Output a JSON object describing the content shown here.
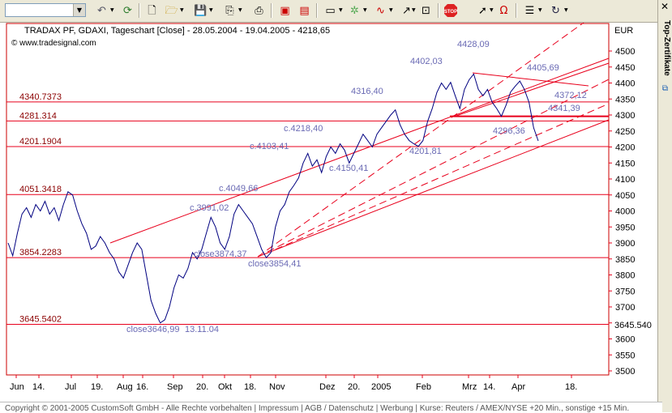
{
  "toolbar": {
    "combo_value": "",
    "buttons": [
      "back-arrow-icon",
      "refresh-icon",
      "new-doc-icon",
      "open-folder-icon",
      "save-icon",
      "copy-icon",
      "print-icon",
      "chart-window-icon",
      "chart-window-2-icon",
      "chart-type-icon",
      "indicator-icon",
      "drawing-tools-icon",
      "zoom-fit-icon",
      "stop-icon",
      "pointer-icon",
      "magnet-icon",
      "trade-list-icon",
      "undo-redo-icon"
    ]
  },
  "sidebar": {
    "label": "Top-Zertifikate"
  },
  "chart": {
    "title": "TRADAX PF, GDAXI, Tageschart [Close] - 28.05.2004 - 19.04.2005 - 4218,65",
    "source": "© www.tradesignal.com",
    "currency": "EUR",
    "y_ticks": [
      "4500",
      "4450",
      "4400",
      "4350",
      "4300",
      "4250",
      "4200",
      "4150",
      "4100",
      "4050",
      "4000",
      "3950",
      "3900",
      "3850",
      "3800",
      "3750",
      "3700",
      "3650",
      "3600",
      "3550",
      "3500"
    ],
    "x_ticks": [
      "Jun",
      "14.",
      "Jul",
      "19.",
      "Aug",
      "16.",
      "Sep",
      "20.",
      "Okt",
      "18.",
      "Nov",
      "Dez",
      "20.",
      "2005",
      "Feb",
      "Mrz",
      "14.",
      "Apr",
      "18."
    ],
    "hline_labels": [
      "4340.7373",
      "4281.314",
      "4201.1904",
      "4051.3418",
      "3854.2283",
      "3645.5402"
    ],
    "last_price_label": "3645.540",
    "annotations": [
      "4428,09",
      "4402,03",
      "4405,69",
      "4316,40",
      "4372,12",
      "4341,39",
      "c.4218,40",
      "4296,36",
      "c.4103,41",
      "4201,81",
      "c.4150,41",
      "c.4049,66",
      "c.3991,02",
      "close3874,37",
      "close3854,41",
      "close3646,99",
      "13.11.04"
    ],
    "line_color": "#e8001c",
    "price_color": "#000080",
    "annotation_color": "#6a6ab4"
  },
  "chart_data": {
    "type": "line",
    "title": "TRADAX PF, GDAXI, Tageschart [Close] - 28.05.2004 - 19.04.2005 - 4218,65",
    "ylabel": "EUR",
    "ylim": [
      3500,
      4500
    ],
    "x_range": [
      "2004-05-28",
      "2005-04-19"
    ],
    "horizontal_levels": [
      4340.7373,
      4281.314,
      4201.1904,
      4051.3418,
      3854.2283,
      3645.5402
    ],
    "series": [
      {
        "values": [
          3900,
          3860,
          3930,
          3990,
          4010,
          3980,
          4020,
          4000,
          4030,
          3990,
          4010,
          3970,
          4020,
          4060,
          4050,
          4000,
          3960,
          3930,
          3880,
          3890,
          3920,
          3900,
          3870,
          3850,
          3810,
          3790,
          3830,
          3870,
          3900,
          3880,
          3800,
          3720,
          3680,
          3650,
          3660,
          3700,
          3760,
          3800,
          3790,
          3820,
          3870,
          3850,
          3880,
          3930,
          3980,
          3950,
          3900,
          3880,
          3920,
          3990,
          4020,
          4000,
          3980,
          3960,
          3920,
          3880,
          3854,
          3870,
          3950,
          4000,
          4020,
          4060,
          4080,
          4103,
          4150,
          4180,
          4140,
          4160,
          4120,
          4170,
          4200,
          4180,
          4210,
          4190,
          4150,
          4180,
          4210,
          4240,
          4220,
          4200,
          4240,
          4260,
          4280,
          4300,
          4316,
          4270,
          4240,
          4220,
          4210,
          4202,
          4220,
          4280,
          4320,
          4370,
          4400,
          4380,
          4402,
          4360,
          4320,
          4380,
          4410,
          4428,
          4380,
          4360,
          4380,
          4340,
          4320,
          4296,
          4330,
          4372,
          4390,
          4406,
          4380,
          4340,
          4260,
          4219
        ]
      }
    ]
  },
  "footer": {
    "text": "Copyright © 2001-2005 CustomSoft GmbH - Alle Rechte vorbehalten  |  Impressum  |  AGB / Datenschutz  |  Werbung  |  Kurse: Reuters / AMEX/NYSE +20 Min., sonstige +15 Min."
  }
}
